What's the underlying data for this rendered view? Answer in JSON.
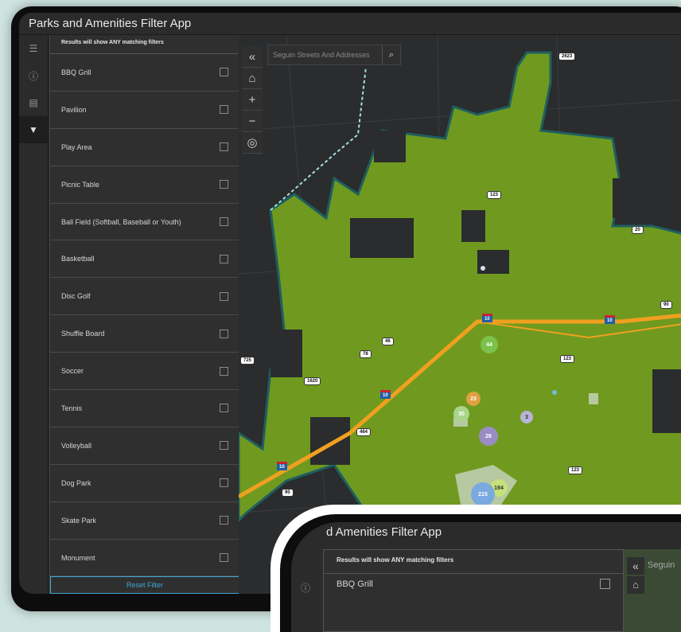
{
  "app": {
    "title": "Parks and Amenities Filter App",
    "title_visible": "Parks and Amenities Filter App"
  },
  "rail": {
    "icons": [
      "layers-icon",
      "info-icon",
      "legend-icon",
      "filter-icon"
    ]
  },
  "panel": {
    "heading": "Results will show ANY matching filters",
    "filters": [
      {
        "label": "BBQ Grill"
      },
      {
        "label": "Pavilion"
      },
      {
        "label": "Play Area"
      },
      {
        "label": "Picnic Table"
      },
      {
        "label": "Ball Field (Softball, Baseball or Youth)"
      },
      {
        "label": "Basketball"
      },
      {
        "label": "Disc Golf"
      },
      {
        "label": "Shuffle Board"
      },
      {
        "label": "Soccer"
      },
      {
        "label": "Tennis"
      },
      {
        "label": "Volleyball"
      },
      {
        "label": "Dog Park"
      },
      {
        "label": "Skate Park"
      },
      {
        "label": "Monument"
      }
    ],
    "reset_label": "Reset Filter"
  },
  "map": {
    "search_placeholder": "Seguin Streets And Addresses",
    "collapse_glyph": "«",
    "home_glyph": "⌂",
    "zoom_in": "+",
    "zoom_out": "−",
    "locate_glyph": "◎",
    "search_glyph": "⌕",
    "highway_labels": [
      "2623",
      "123",
      "20",
      "90",
      "10",
      "10",
      "46",
      "78",
      "725",
      "1620",
      "123",
      "10",
      "464",
      "10",
      "123",
      "90"
    ],
    "clusters": [
      "44",
      "23",
      "30",
      "26",
      "3",
      "194",
      "215"
    ],
    "colors": {
      "city_area": "#6f9a1f",
      "highway": "#f0a020",
      "background": "#2a2c2e"
    }
  },
  "inset": {
    "title": "d Amenities Filter App",
    "heading": "Results will show ANY matching filters",
    "first_filter": "BBQ Grill",
    "search_fragment": "Seguin"
  }
}
